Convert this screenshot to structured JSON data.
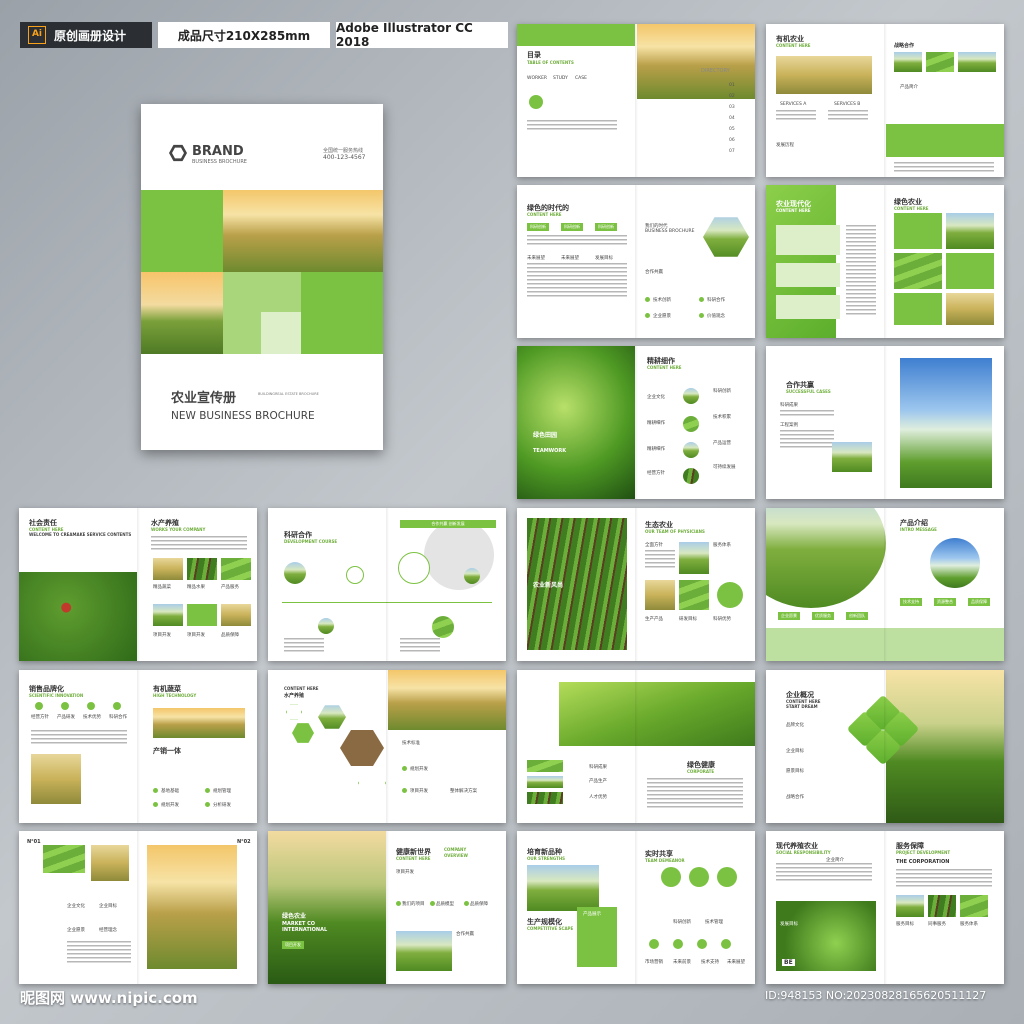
{
  "header": {
    "tag1_icon": "Ai",
    "tag1": "原创画册设计",
    "tag2": "成品尺寸210X285mm",
    "tag3": "Adobe Illustrator CC 2018"
  },
  "cover": {
    "brand": "BRAND",
    "brand_sub": "BUSINESS BROCHURE",
    "hotline_label": "全国统一服务热线",
    "phone": "400-123-4567",
    "title_cn": "农业宣传册",
    "title_sub": "BUILDINGREAL ESTATE BROCHURE",
    "title_en": "NEW BUSINESS BROCHURE"
  },
  "spreads": {
    "toc": {
      "title": "目录",
      "sub": "TABLE OF CONTENTS",
      "labels": [
        "WORKER",
        "STUDY",
        "CASE"
      ],
      "directory": "DIRECTORY",
      "nums": [
        "01",
        "02",
        "03",
        "04",
        "05",
        "06",
        "07"
      ]
    },
    "organic": {
      "title": "有机农业",
      "sub": "CONTENT HERE",
      "t2": "战略合作",
      "l1": "SERVICES A",
      "l2": "SERVICES B",
      "l3": "产品简介",
      "l4": "发展历程"
    },
    "green_era": {
      "title": "绿色的时代的",
      "sub": "CONTENT HERE",
      "b1": "科研创新",
      "b2": "科研创新",
      "b3": "科研创新",
      "l1": "未来展望",
      "l2": "未来展望",
      "l3": "发展目标",
      "t2": "我们的时代",
      "t2sub": "BUSINESS BROCHURE",
      "l4": "合作共赢",
      "i1": "技术创新",
      "i2": "科研合作",
      "i3": "企业愿景",
      "i4": "价值观念"
    },
    "modern": {
      "title": "农业现代化",
      "sub": "CONTENT HERE",
      "t2": "绿色农业",
      "t2sub": "CONTENT HERE"
    },
    "farming": {
      "t_overlay": "绿色田园",
      "sub_overlay": "TEAMWORK",
      "title": "精耕细作",
      "sub": "CONTENT HERE",
      "l1": "企业文化",
      "l2": "精耕细作",
      "l3": "精耕细作",
      "l4": "经营方针",
      "l5": "科研创新",
      "l6": "技术积累",
      "l7": "产品运营",
      "l8": "可持续发展"
    },
    "coop": {
      "title": "合作共赢",
      "sub": "SUCCESSFUL CASES",
      "l1": "科研成果",
      "l2": "工程案例"
    },
    "social": {
      "title": "社会责任",
      "sub": "CONTENT HERE",
      "sub2": "WELCOME TO CREAMAKE SERVICE CONTENTS",
      "t2": "水产养殖",
      "t2sub": "WORKS YOUR COMPANY",
      "l1": "精品蔬菜",
      "l2": "精品水果",
      "l3": "产品服务",
      "l4": "项目开发",
      "l5": "项目开发",
      "l6": "品质保障"
    },
    "research": {
      "title": "科研合作",
      "sub": "DEVELOPMENT COURSE",
      "bar": "合作共赢 创新发展"
    },
    "eco": {
      "overlay": "农业新风尚",
      "title": "生态农业",
      "sub": "OUR TEAM OF PHYSICIANS",
      "l1": "全面方针",
      "l2": "服务体系",
      "l3": "全面体系",
      "l4": "生产产品",
      "l5": "研发目标",
      "l6": "科研优势"
    },
    "product_intro": {
      "title": "产品介绍",
      "sub": "INTRO MESSAGE",
      "i1": "企业愿景",
      "i2": "优质服务",
      "i3": "创新团队",
      "i4": "技术支持",
      "i5": "资源整合",
      "i6": "品质保障"
    },
    "sales": {
      "title": "销售品牌化",
      "sub": "SCIENTIFIC INNOVATION",
      "l1": "经营方针",
      "l2": "产品研发",
      "l3": "技术优势",
      "l4": "科研合作",
      "t2": "有机蔬菜",
      "t2sub": "HIGH TECHNOLOGY",
      "t3": "产销一体",
      "n1": "基地基础",
      "n2": "规划管理",
      "n3": "规划开发",
      "n4": "分析研发"
    },
    "aqua": {
      "title": "CONTENT HERE",
      "t2": "水产养殖",
      "l1": "技术标准",
      "l2": "规划开发",
      "l3": "项目开发",
      "l4": "整体解决方案"
    },
    "health": {
      "title": "绿色健康",
      "sub": "CORPORATE",
      "l1": "科研成果",
      "l2": "产品生产",
      "l3": "人才优势"
    },
    "overview": {
      "title": "企业概况",
      "sub": "CONTENT HERE",
      "sub2": "START DREAM",
      "l1": "品牌文化",
      "l2": "企业目标",
      "l3": "愿景目标",
      "l4": "战略合作"
    },
    "n01": {
      "p1": "N°01",
      "p2": "N°02",
      "l1": "企业文化",
      "l2": "企业目标",
      "l3": "企业愿景",
      "l4": "经营理念"
    },
    "healthy_world": {
      "overlay": "绿色农业",
      "overlay_sub": "MARKET CO INTERNATIONAL",
      "btn": "项目开发",
      "title": "健康新世界",
      "sub": "CONTENT HERE",
      "t2": "COMPANY",
      "t2sub": "OVERVIEW",
      "l1": "项目开发",
      "l2": "我们的项目",
      "l3": "品质模型",
      "l4": "品质保障",
      "l5": "合作共赢"
    },
    "cultivate": {
      "title": "培育新品种",
      "sub": "OUR STRENGTHS",
      "t2": "生产规模化",
      "t2sub": "COMPETITIVE SCAPE",
      "box": "产品展示",
      "t3": "实时共享",
      "t3sub": "TEAM DEMEANOR",
      "l1": "科研创新",
      "l2": "技术管理",
      "l3": "市场营销",
      "l4": "未来前景",
      "l5": "技术支持",
      "l6": "未来展望"
    },
    "eco_social": {
      "title": "现代养殖农业",
      "sub": "SOCIAL RESPONSIBILITY",
      "l1": "企业简介",
      "l2": "发展目标",
      "be": "BE",
      "t2": "服务保障",
      "t2sub": "PROJECT DEVELOPMENT",
      "t3": "THE CORPORATION",
      "i1": "服务目标",
      "i2": "同事服务",
      "i3": "服务体系"
    }
  },
  "footer": {
    "left": "昵图网 www.nipic.com",
    "right": "ID:948153 NO:20230828165620511127"
  }
}
